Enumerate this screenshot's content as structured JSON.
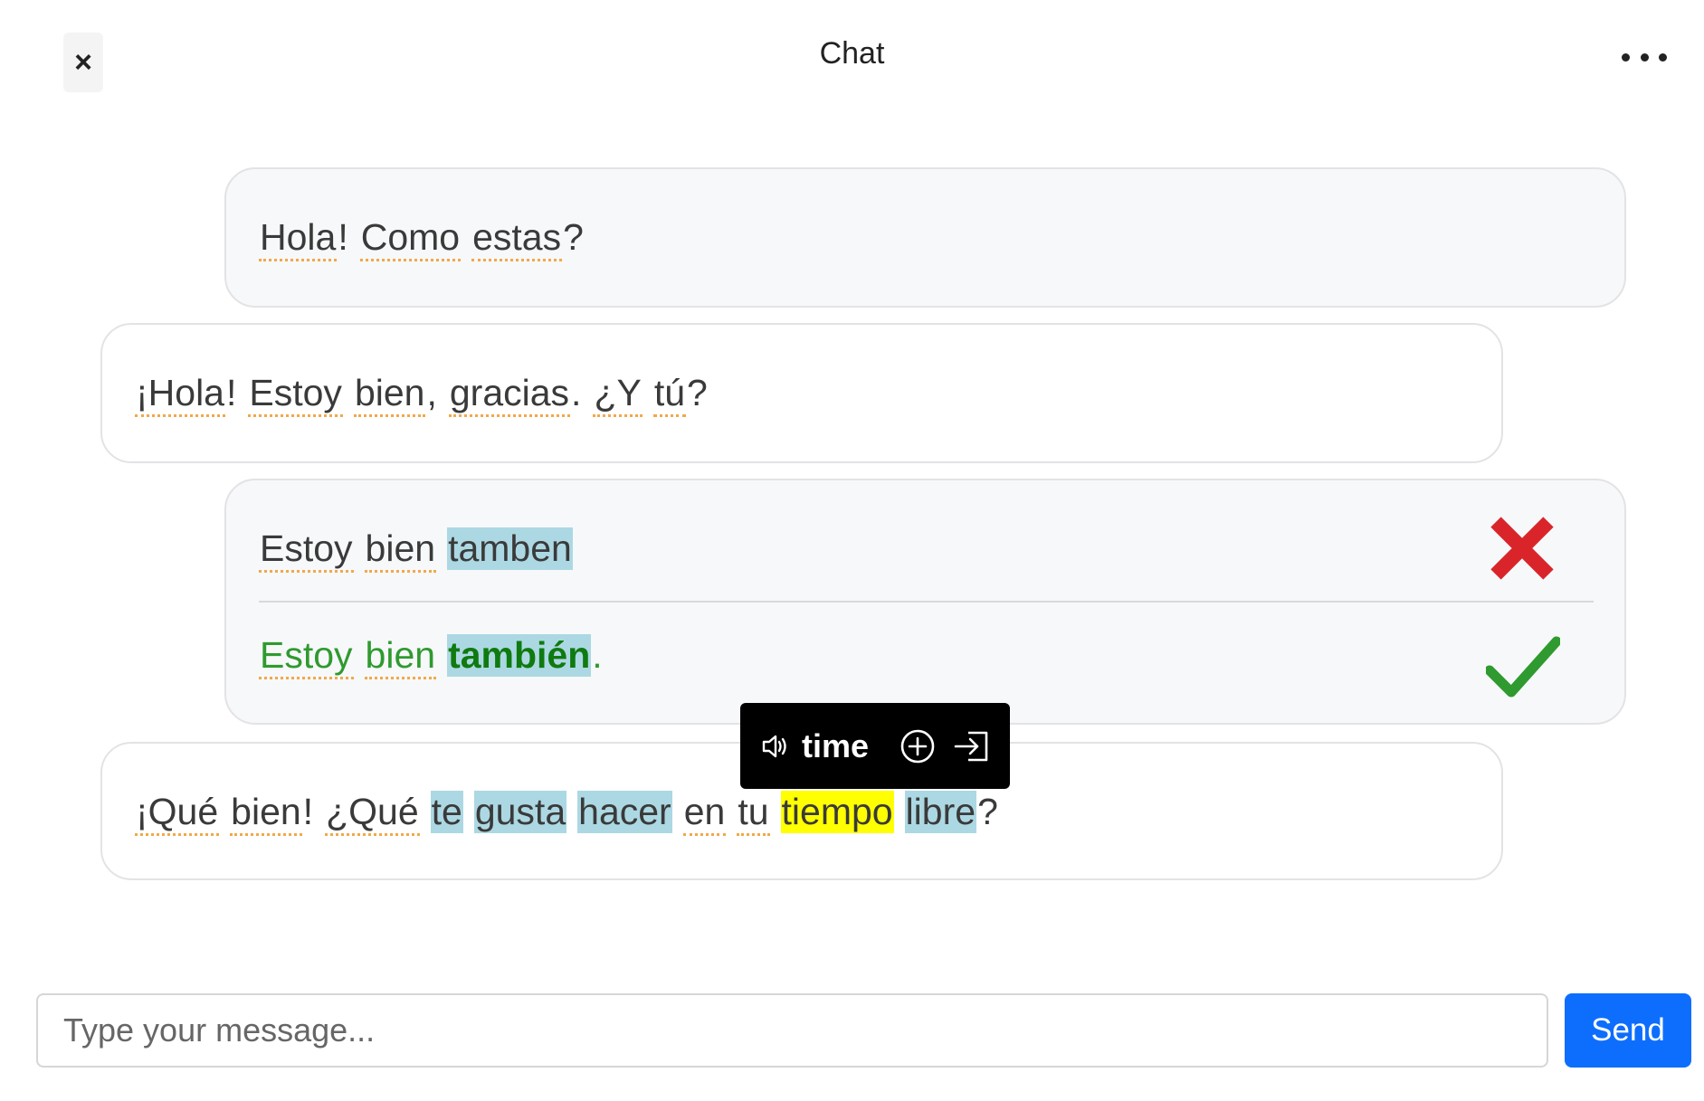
{
  "header": {
    "title": "Chat",
    "close_label": "×"
  },
  "messages": [
    {
      "role": "user",
      "tokens": [
        {
          "t": "Hola",
          "dotted": true
        },
        {
          "t": "!",
          "sep": true
        },
        {
          "t": "Como",
          "dotted": true
        },
        {
          "t": "estas",
          "dotted": true
        },
        {
          "t": "?",
          "sep": true
        }
      ]
    },
    {
      "role": "assistant",
      "tokens": [
        {
          "t": "¡Hola",
          "dotted": true
        },
        {
          "t": "!",
          "sep": true
        },
        {
          "t": "Estoy",
          "dotted": true
        },
        {
          "t": "bien",
          "dotted": true
        },
        {
          "t": ",",
          "sep": true
        },
        {
          "t": "gracias",
          "dotted": true
        },
        {
          "t": ".",
          "sep": true
        },
        {
          "t": "¿Y",
          "dotted": true
        },
        {
          "t": "tú",
          "dotted": true
        },
        {
          "t": "?",
          "sep": true
        }
      ]
    },
    {
      "role": "user",
      "original": [
        {
          "t": "Estoy",
          "dotted": true
        },
        {
          "t": "bien",
          "dotted": true
        },
        {
          "t": "tamben",
          "hl": "blue"
        }
      ],
      "correction": [
        {
          "t": "Estoy",
          "dotted": true
        },
        {
          "t": "bien",
          "dotted": true
        },
        {
          "t": "también",
          "hl": "blue",
          "bold": true
        },
        {
          "t": ".",
          "sep": true
        }
      ]
    },
    {
      "role": "assistant",
      "tokens": [
        {
          "t": "¡Qué",
          "dotted": true
        },
        {
          "t": "bien",
          "dotted": true
        },
        {
          "t": "!",
          "sep": true
        },
        {
          "t": "¿Qué",
          "dotted": true
        },
        {
          "t": "te",
          "hl": "blue"
        },
        {
          "t": "gusta",
          "hl": "blue"
        },
        {
          "t": "hacer",
          "hl": "blue"
        },
        {
          "t": "en",
          "dotted": true
        },
        {
          "t": "tu",
          "dotted": true
        },
        {
          "t": "tiempo",
          "hl": "yellow"
        },
        {
          "t": "libre",
          "hl": "blue"
        },
        {
          "t": "?",
          "sep": true
        }
      ]
    }
  ],
  "popup": {
    "word": "time",
    "icons": [
      "speaker-icon",
      "add-circle-icon",
      "enter-icon"
    ]
  },
  "composer": {
    "placeholder": "Type your message...",
    "value": "",
    "send_label": "Send"
  },
  "colors": {
    "send": "#0d6efd",
    "highlight_blue": "#acd8e3",
    "highlight_yellow": "#ffff00",
    "correct_green": "#2f9a2f",
    "wrong_red": "#d9252a",
    "dotted_underline": "#f0a94a"
  }
}
